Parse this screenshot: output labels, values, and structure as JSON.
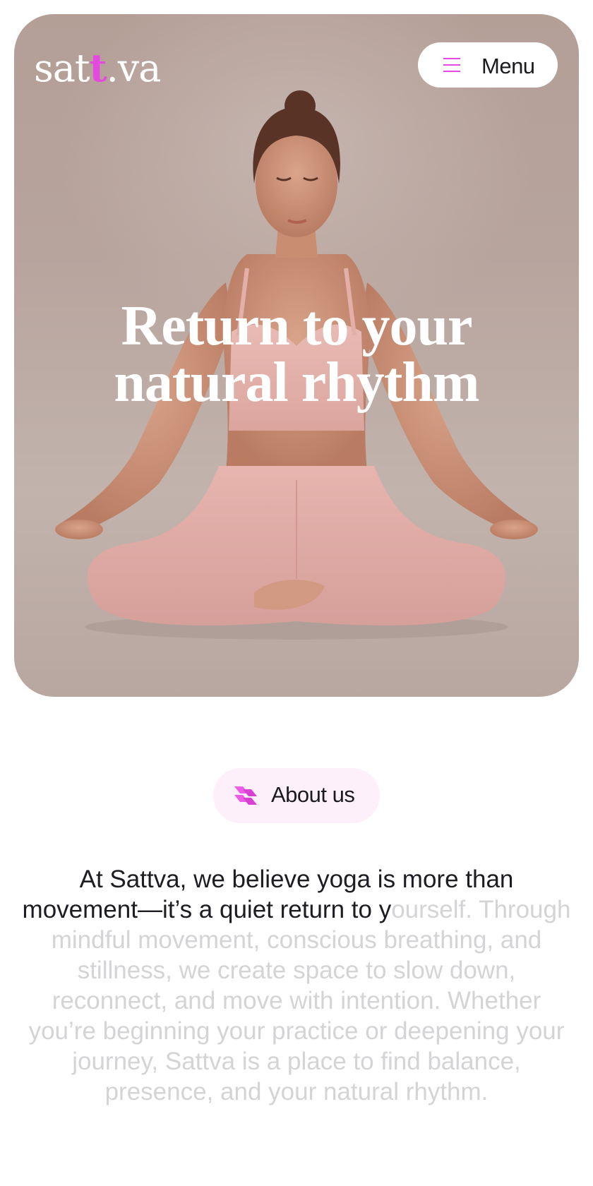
{
  "brand": {
    "logo_part1": "sat",
    "logo_accent": "t",
    "logo_part2": ".va",
    "accent_color": "#e44ae0"
  },
  "header": {
    "menu_label": "Menu",
    "menu_icon": "hamburger-icon"
  },
  "hero": {
    "title_line1": "Return to your",
    "title_line2": "natural rhythm",
    "image": "woman-meditating-lotus-pose"
  },
  "about": {
    "badge_label": "About us",
    "badge_icon": "sattva-mark-icon",
    "text_highlighted": "At Sattva, we believe yoga is more than movement—it’s a quiet return to y",
    "text_faded": "ourself. Through mindful movement, conscious breathing, and stillness, we create space to slow down, reconnect, and move with intention. Whether you’re beginning your practice or deepening your journey, Sattva is a place to find balance, presence, and your natural rhythm."
  }
}
